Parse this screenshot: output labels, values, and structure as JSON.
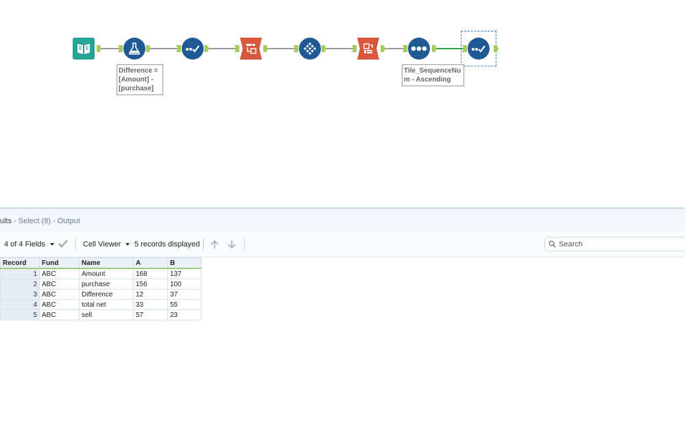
{
  "annotations": {
    "formula": [
      "Difference =",
      "[Amount] -",
      "[purchase]"
    ],
    "tile": [
      "Tile_SequenceNu",
      "m - Ascending"
    ]
  },
  "results": {
    "title_prefix": "ults",
    "title_suffix": " - Select (8) - Output",
    "fields_label": "4 of 4 Fields",
    "cell_viewer_label": "Cell Viewer",
    "records_label": "5 records displayed",
    "search_placeholder": "Search"
  },
  "grid": {
    "columns": [
      "Record",
      "Fund",
      "Name",
      "A",
      "B"
    ],
    "rows": [
      [
        "1",
        "ABC",
        "Amount",
        "168",
        "137"
      ],
      [
        "2",
        "ABC",
        "purchase",
        "156",
        "100"
      ],
      [
        "3",
        "ABC",
        "Difference",
        "12",
        "37"
      ],
      [
        "4",
        "ABC",
        "total net",
        "33",
        "55"
      ],
      [
        "5",
        "ABC",
        "sell",
        "57",
        "23"
      ]
    ]
  },
  "colors": {
    "tool_blue": "#1f5a94",
    "tool_orange": "#d9583d",
    "tool_teal": "#24a396",
    "anchor_green": "#a4cc5c",
    "selection": "#3a86d1"
  },
  "icons": [
    "book-icon",
    "flask-icon",
    "check-select-icon",
    "transpose-icon",
    "diamond-grid-icon",
    "crosstab-icon",
    "dots-icon",
    "check-select-icon"
  ]
}
